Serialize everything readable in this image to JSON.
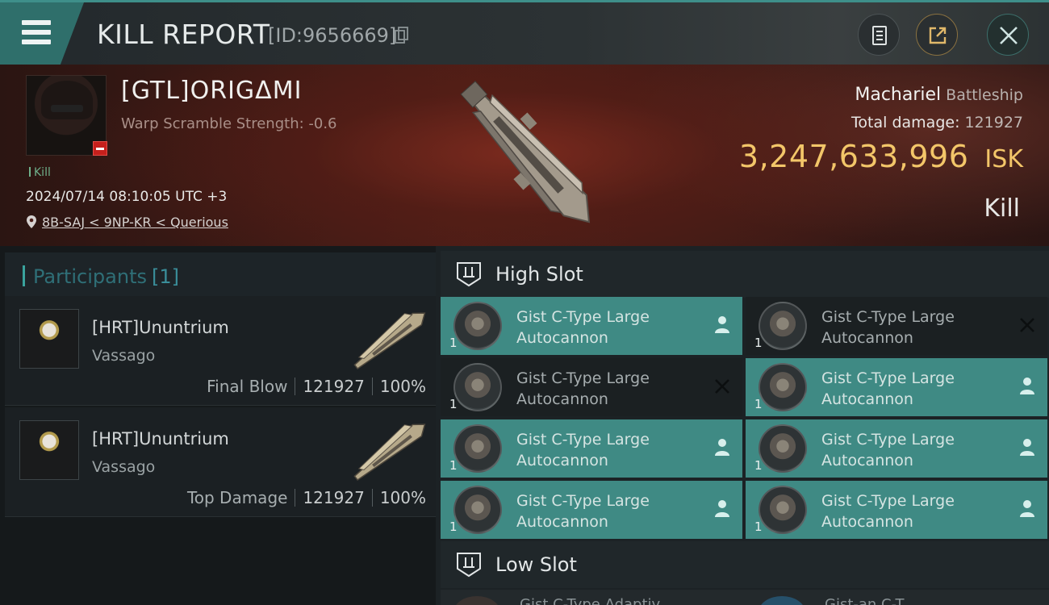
{
  "header": {
    "title": "KILL REPORT",
    "report_id": "[ID:9656669]"
  },
  "victim": {
    "name": "[GTL]ORIGΔMI",
    "scramble": "Warp Scramble Strength: -0.6",
    "kill_tag": "Kill",
    "datetime": "2024/07/14 08:10:05 UTC +3",
    "location": "8B-SAJ < 9NP-KR < Querious",
    "ship": "Machariel",
    "ship_class": "Battleship",
    "total_damage_label": "Total damage:",
    "total_damage": "121927",
    "isk_value": "3,247,633,996",
    "isk_unit": "ISK",
    "result": "Kill"
  },
  "participants": {
    "label": "Participants",
    "count": "[1]",
    "items": [
      {
        "name": "[HRT]Ununtrium",
        "ship": "Vassago",
        "role": "Final Blow",
        "damage": "121927",
        "percent": "100%"
      },
      {
        "name": "[HRT]Ununtrium",
        "ship": "Vassago",
        "role": "Top Damage",
        "damage": "121927",
        "percent": "100%"
      }
    ]
  },
  "slots": {
    "high_label": "High Slot",
    "low_label": "Low Slot",
    "high_modules": [
      {
        "line1": "Gist C-Type Large",
        "line2": "Autocannon",
        "qty": "1",
        "status": "dropped"
      },
      {
        "line1": "Gist C-Type Large",
        "line2": "Autocannon",
        "qty": "1",
        "status": "destroyed"
      },
      {
        "line1": "Gist C-Type Large",
        "line2": "Autocannon",
        "qty": "1",
        "status": "destroyed"
      },
      {
        "line1": "Gist C-Type Large",
        "line2": "Autocannon",
        "qty": "1",
        "status": "dropped"
      },
      {
        "line1": "Gist C-Type Large",
        "line2": "Autocannon",
        "qty": "1",
        "status": "dropped"
      },
      {
        "line1": "Gist C-Type Large",
        "line2": "Autocannon",
        "qty": "1",
        "status": "dropped"
      },
      {
        "line1": "Gist C-Type Large",
        "line2": "Autocannon",
        "qty": "1",
        "status": "dropped"
      },
      {
        "line1": "Gist C-Type Large",
        "line2": "Autocannon",
        "qty": "1",
        "status": "dropped"
      }
    ],
    "low_partial": [
      "Gist C-Type Adaptiv",
      "Gist-an C-T"
    ]
  },
  "colors": {
    "accent": "#3f8a84",
    "isk_gold": "#f3c669",
    "destroyed_bg": "#1b2022",
    "banner_red": "#4a1d17"
  },
  "icons": {
    "menu": "hamburger-icon",
    "copy": "copy-icon",
    "doc": "document-icon",
    "share": "share-icon",
    "close": "close-icon",
    "location": "map-pin-icon",
    "slot": "high-slot-icon",
    "dropped": "person-icon",
    "destroyed": "x-icon"
  }
}
